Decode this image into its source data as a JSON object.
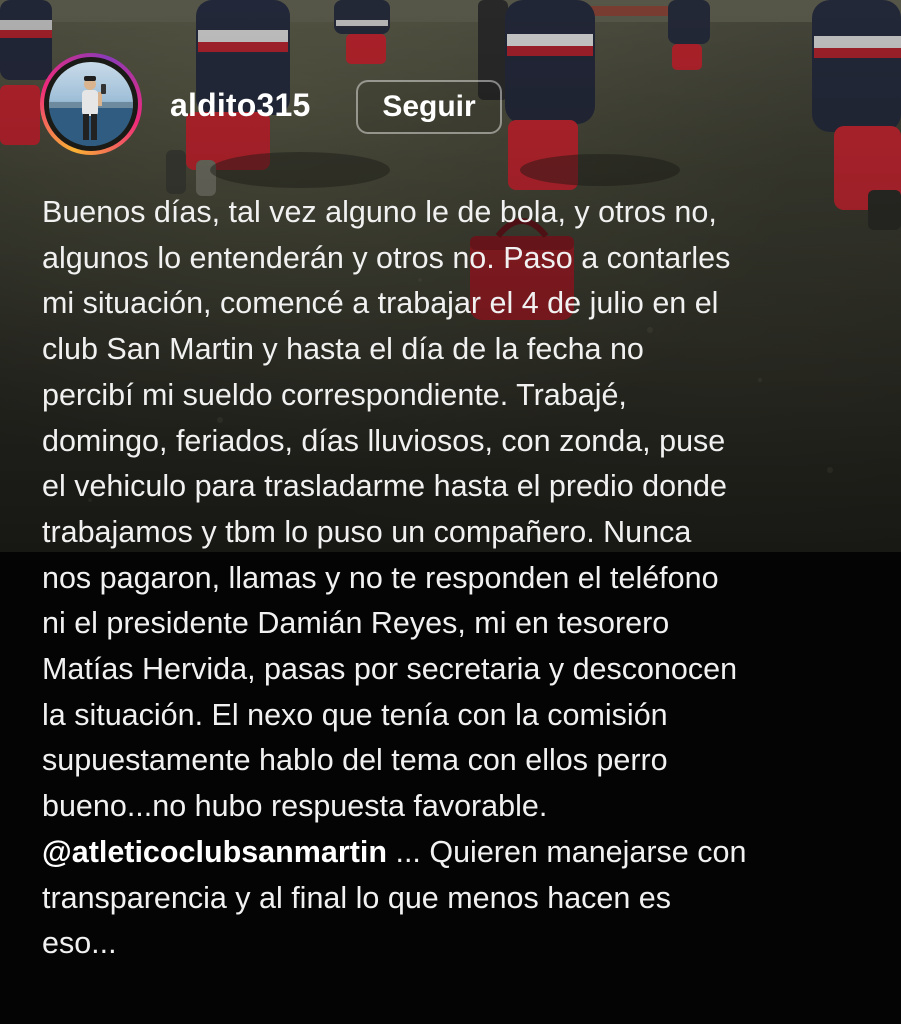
{
  "post": {
    "username": "aldito315",
    "follow_label": "Seguir",
    "avatar_icon": "profile-photo-person-by-lake",
    "story_ring_colors": [
      "#f9b233",
      "#ee2a7b",
      "#8a3ab9"
    ]
  },
  "caption": {
    "lines": [
      "Buenos días, tal vez alguno le de bola, y otros no,",
      "algunos lo entenderán y otros no. Paso a contarles",
      "mi situación, comencé a trabajar el 4 de julio en el",
      "club San Martin y hasta el día de la fecha no",
      "percibí mi sueldo correspondiente. Trabajé,",
      "domingo, feriados, días lluviosos, con zonda, puse",
      "el vehiculo para trasladarme hasta el predio donde",
      "trabajamos y tbm lo puso un compañero. Nunca",
      "nos pagaron, llamas y no te responden el teléfono",
      "ni el presidente Damián Reyes, mi en tesorero",
      "Matías Hervida, pasas por secretaria y desconocen",
      "la situación. El nexo que tenía con la comisión",
      "supuestamente hablo del tema con ellos perro",
      "bueno...no hubo respuesta favorable."
    ],
    "mention": "@atleticoclubsanmartin",
    "after_mention": " ... Quieren manejarse con",
    "closing_lines": [
      "transparencia y al final lo que menos hacen es",
      "eso..."
    ]
  },
  "background": {
    "photo_icon": "team-training-photo",
    "bottom_color": "#040404"
  }
}
